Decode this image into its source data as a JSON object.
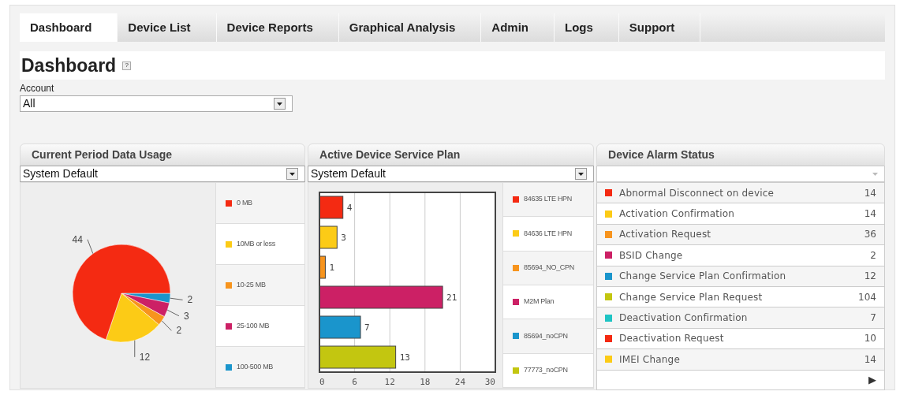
{
  "tabs": [
    {
      "label": "Dashboard",
      "selected": true
    },
    {
      "label": "Device List",
      "selected": false
    },
    {
      "label": "Device Reports",
      "selected": false
    },
    {
      "label": "Graphical Analysis",
      "selected": false
    },
    {
      "label": "Admin",
      "selected": false
    },
    {
      "label": "Logs",
      "selected": false
    },
    {
      "label": "Support",
      "selected": false
    }
  ],
  "page_title": "Dashboard",
  "help_icon": "?",
  "account": {
    "label": "Account",
    "value": "All"
  },
  "data_usage": {
    "title": "Current Period Data Usage",
    "select_value": "System Default",
    "legend": [
      "0 MB",
      "10MB or less",
      "10-25 MB",
      "25-100 MB",
      "100-500 MB"
    ],
    "chart_data": {
      "type": "pie",
      "values": [
        44,
        12,
        2,
        3,
        2
      ],
      "colors": [
        "#f42a12",
        "#fccb16",
        "#f7941d",
        "#cc2065",
        "#1a95cc"
      ],
      "data_labels": true
    }
  },
  "service_plan": {
    "title": "Active Device Service Plan",
    "select_value": "System Default",
    "legend": [
      "84635 LTE HPN",
      "84636 LTE HPN",
      "85694_NO_CPN",
      "M2M Plan",
      "85694_noCPN",
      "77773_noCPN"
    ],
    "chart_data": {
      "type": "bar",
      "orientation": "horizontal",
      "values": [
        4,
        3,
        1,
        21,
        7,
        13
      ],
      "colors": [
        "#f42a12",
        "#fccb16",
        "#f7941d",
        "#cc2065",
        "#1a95cc",
        "#c3c610"
      ],
      "xlim": [
        0,
        30
      ],
      "xticks": [
        0,
        6,
        12,
        18,
        24,
        30
      ],
      "grid": true,
      "data_labels": true
    }
  },
  "alarm_status": {
    "title": "Device Alarm Status",
    "next_icon": "▶",
    "items": [
      {
        "label": "Abnormal Disconnect on device",
        "count": "14",
        "color": "#f42a12"
      },
      {
        "label": "Activation Confirmation",
        "count": "14",
        "color": "#fccb16"
      },
      {
        "label": "Activation Request",
        "count": "36",
        "color": "#f7941d"
      },
      {
        "label": "BSID Change",
        "count": "2",
        "color": "#cc2065"
      },
      {
        "label": "Change Service Plan Confirmation",
        "count": "12",
        "color": "#1a95cc"
      },
      {
        "label": "Change Service Plan Request",
        "count": "104",
        "color": "#c3c610"
      },
      {
        "label": "Deactivation Confirmation",
        "count": "7",
        "color": "#1ec4c4"
      },
      {
        "label": "Deactivation Request",
        "count": "10",
        "color": "#f42a12"
      },
      {
        "label": "IMEI Change",
        "count": "14",
        "color": "#fccb16"
      }
    ]
  }
}
